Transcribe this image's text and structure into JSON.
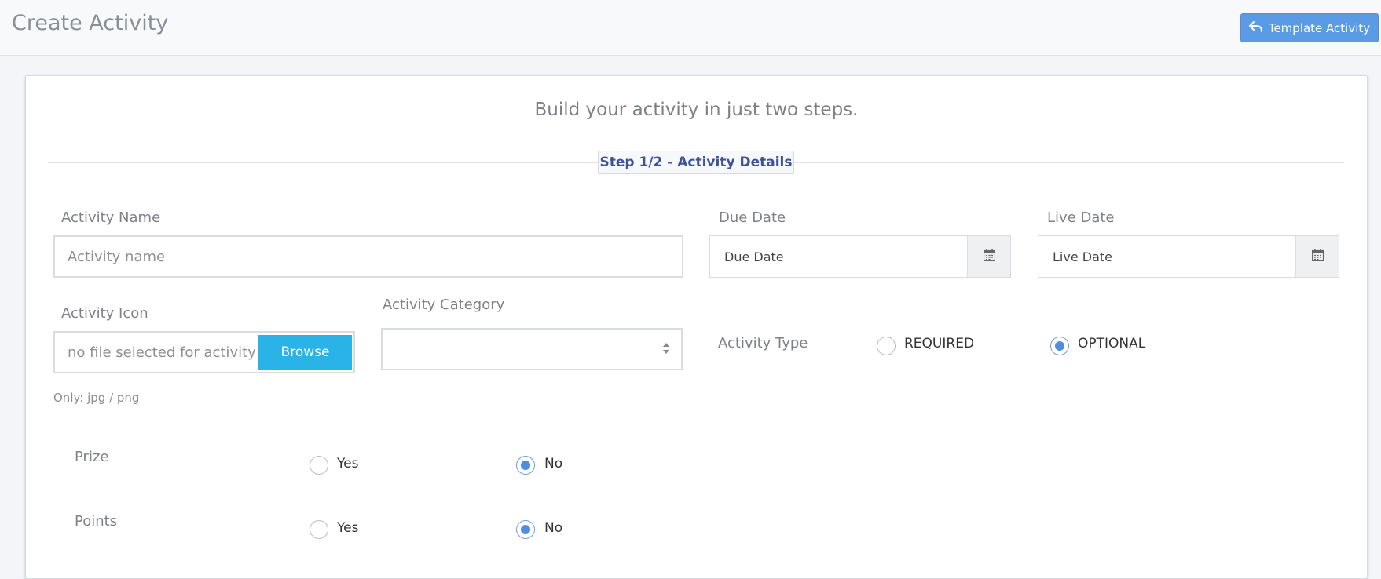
{
  "header": {
    "title": "Create Activity",
    "template_button": "Template Activity"
  },
  "form": {
    "headline": "Build your activity in just two steps.",
    "step_label": "Step 1/2 - Activity Details",
    "activity_name": {
      "label": "Activity Name",
      "placeholder": "Activity name",
      "value": ""
    },
    "due_date": {
      "label": "Due Date",
      "placeholder": "Due Date"
    },
    "live_date": {
      "label": "Live Date",
      "placeholder": "Live Date"
    },
    "activity_icon": {
      "label": "Activity Icon",
      "file_text": "no file selected for activity",
      "browse_label": "Browse",
      "hint": "Only: jpg / png"
    },
    "activity_category": {
      "label": "Activity Category",
      "selected": ""
    },
    "activity_type": {
      "label": "Activity Type",
      "options": [
        "REQUIRED",
        "OPTIONAL"
      ],
      "selected": "OPTIONAL"
    },
    "prize": {
      "label": "Prize",
      "options": [
        "Yes",
        "No"
      ],
      "selected": "No"
    },
    "points": {
      "label": "Points",
      "options": [
        "Yes",
        "No"
      ],
      "selected": "No"
    }
  },
  "colors": {
    "accent": "#5b9be6",
    "browse": "#29b3e6",
    "step_text": "#3f5394",
    "radio_selected": "#4f8de0"
  },
  "icons": {
    "template_button": "reply-arrow-icon",
    "date_picker": "calendar-icon",
    "select": "select-arrows-icon"
  }
}
